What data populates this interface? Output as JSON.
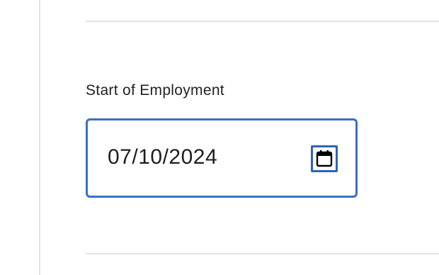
{
  "form": {
    "start_of_employment": {
      "label": "Start of Employment",
      "value": "07/10/2024",
      "picker_icon": "calendar-icon",
      "focus_color": "#3a6fc4"
    }
  }
}
